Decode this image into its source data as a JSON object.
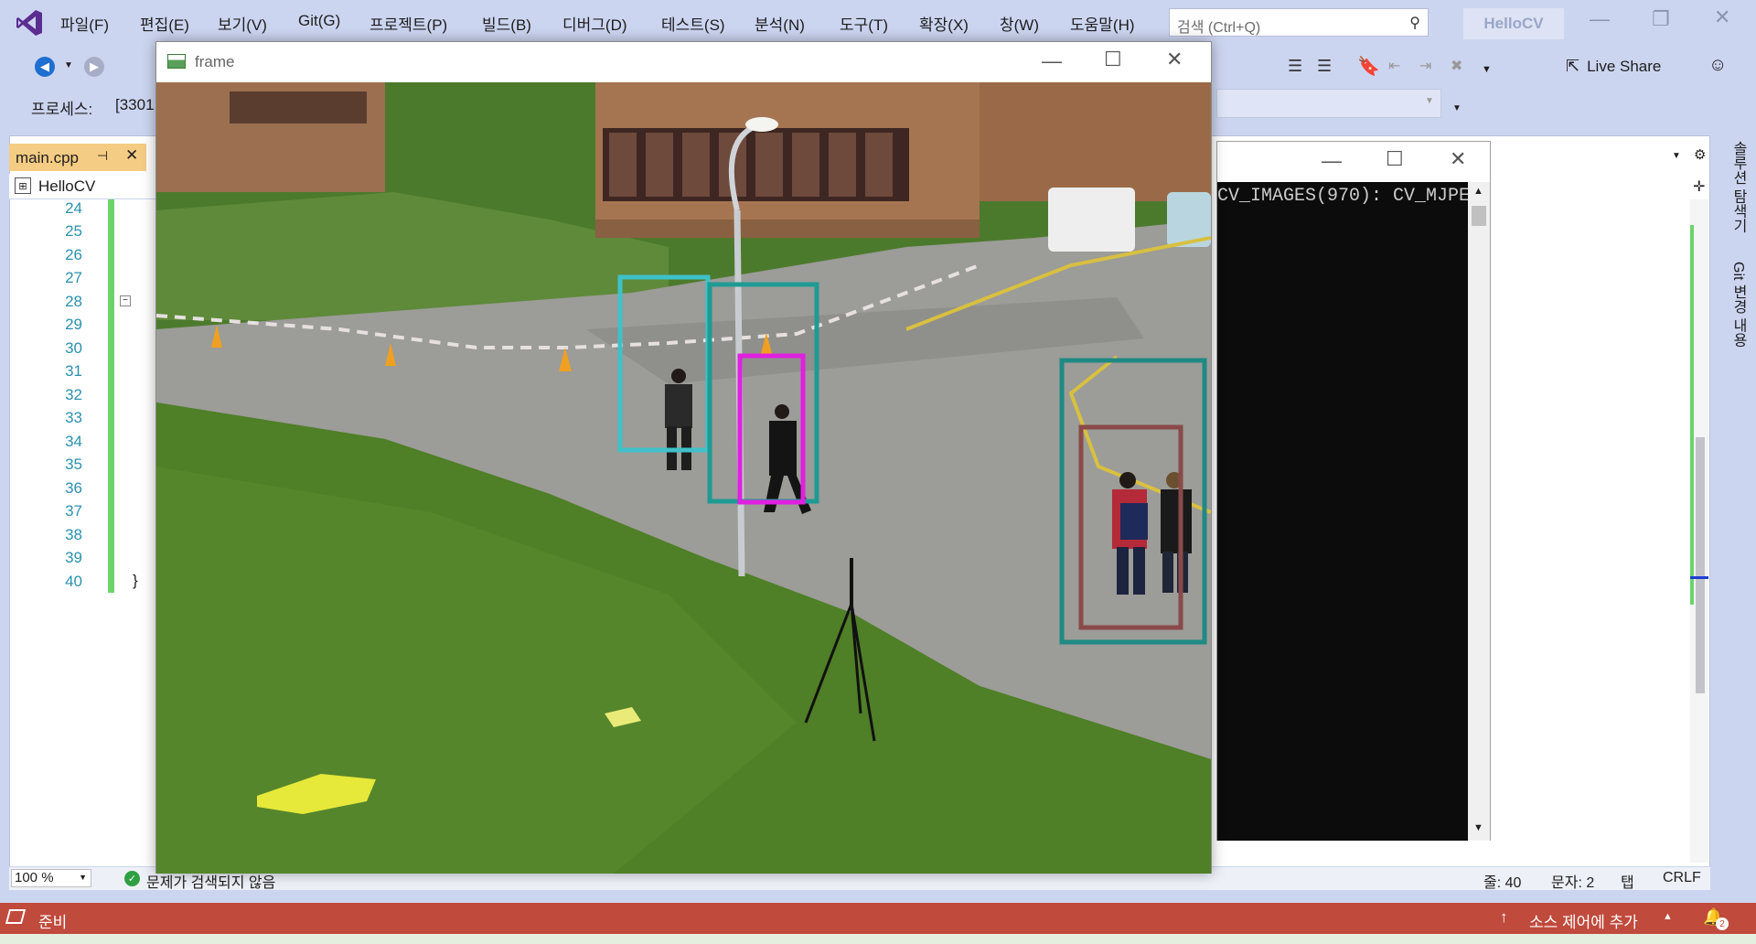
{
  "menubar": {
    "items": [
      "파일(F)",
      "편집(E)",
      "보기(V)",
      "Git(G)",
      "프로젝트(P)",
      "빌드(B)",
      "디버그(D)",
      "테스트(S)",
      "분석(N)",
      "도구(T)",
      "확장(X)",
      "창(W)",
      "도움말(H)"
    ],
    "search_placeholder": "검색 (Ctrl+Q)",
    "project_badge": "HelloCV"
  },
  "toolbar": {
    "live_share_label": "Live Share",
    "process_label": "프로세스:",
    "process_value": "[3301"
  },
  "editor": {
    "tab_label": "main.cpp",
    "nav_project": "HelloCV",
    "line_numbers": [
      "24",
      "25",
      "26",
      "27",
      "28",
      "29",
      "30",
      "31",
      "32",
      "33",
      "34",
      "35",
      "36",
      "37",
      "38",
      "39",
      "40"
    ],
    "last_line_text": "}",
    "right_sidebar": [
      "솔루션 탐색기",
      "Git 변경 내용"
    ]
  },
  "zoom_bar": {
    "zoom": "100 %",
    "issues_text": "문제가 검색되지 않음",
    "line": "줄: 40",
    "char": "문자: 2",
    "tab": "탭",
    "eol": "CRLF"
  },
  "status_bar": {
    "ready": "준비",
    "source_control": "소스 제어에 추가",
    "notification_count": "2"
  },
  "console": {
    "text": "CV_IMAGES(970): CV_MJPE"
  },
  "frame_window": {
    "title": "frame",
    "boxes": [
      {
        "color": "#3fc1c9"
      },
      {
        "color": "#1f9a94"
      },
      {
        "color": "#e020e0"
      },
      {
        "color": "#1f8a84"
      },
      {
        "color": "#8a4a4a"
      }
    ]
  },
  "colors": {
    "vs_chrome": "#ccd5f0",
    "status_bar": "#c04a3c",
    "tab_active": "#f5cc84",
    "line_number": "#2b91af",
    "change_bar": "#6cd36c"
  }
}
